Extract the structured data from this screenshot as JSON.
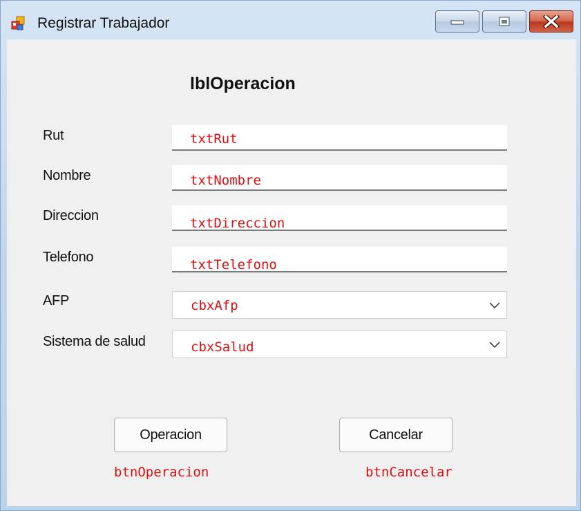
{
  "window": {
    "title": "Registrar Trabajador"
  },
  "form": {
    "heading": "lblOperacion",
    "fields": [
      {
        "label": "Rut",
        "value": "txtRut"
      },
      {
        "label": "Nombre",
        "value": "txtNombre"
      },
      {
        "label": "Direccion",
        "value": "txtDireccion"
      },
      {
        "label": "Telefono",
        "value": "txtTelefono"
      }
    ],
    "combos": [
      {
        "label": "AFP",
        "value": "cbxAfp"
      },
      {
        "label": "Sistema de salud",
        "value": "cbxSalud"
      }
    ]
  },
  "buttons": {
    "operacion": {
      "label": "Operacion",
      "control_name": "btnOperacion"
    },
    "cancelar": {
      "label": "Cancelar",
      "control_name": "btnCancelar"
    }
  },
  "icons": {
    "app": "window-app-icon",
    "minimize": "minimize-icon",
    "maximize": "maximize-icon",
    "close": "close-icon",
    "dropdown": "chevron-down-icon"
  },
  "colors": {
    "designer_name_text": "#d51010",
    "client_background": "#f0f0f0",
    "close_button": "#c8442a"
  }
}
